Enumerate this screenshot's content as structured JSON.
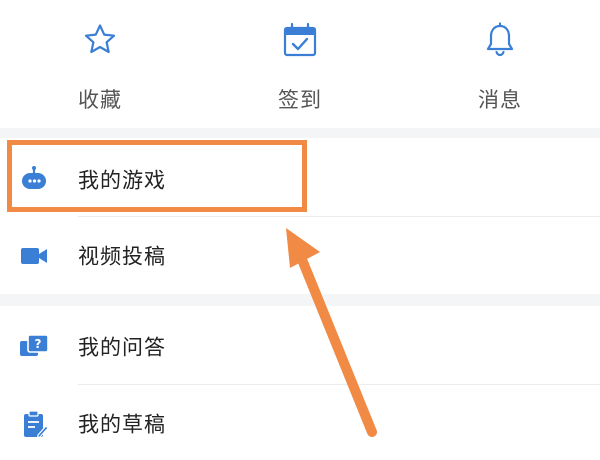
{
  "top_actions": [
    {
      "label": "收藏",
      "icon": "star-icon"
    },
    {
      "label": "签到",
      "icon": "calendar-check-icon"
    },
    {
      "label": "消息",
      "icon": "bell-icon"
    }
  ],
  "menu_items": [
    {
      "label": "我的游戏",
      "icon": "game-controller-icon"
    },
    {
      "label": "视频投稿",
      "icon": "video-camera-icon"
    },
    {
      "label": "我的问答",
      "icon": "question-answer-icon"
    },
    {
      "label": "我的草稿",
      "icon": "draft-clipboard-icon"
    }
  ],
  "colors": {
    "icon_blue": "#3a7fd5",
    "highlight_orange": "#f08a45",
    "separator": "#f4f5f7"
  }
}
